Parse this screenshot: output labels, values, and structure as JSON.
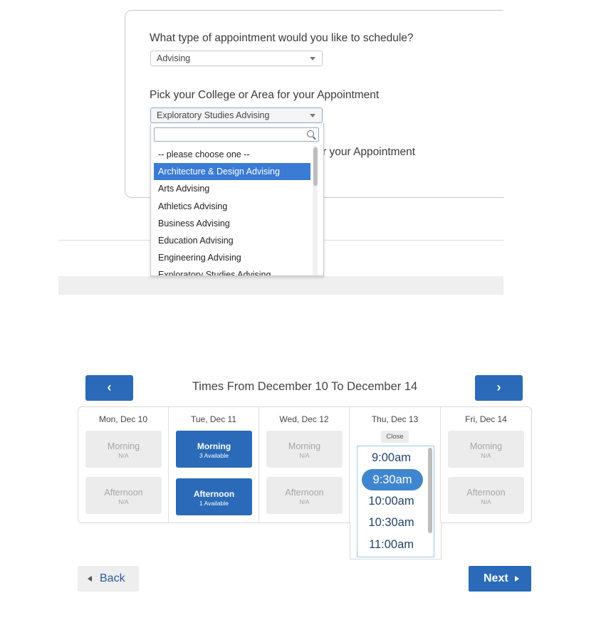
{
  "form": {
    "question1": "What type of appointment would you like to schedule?",
    "select1_value": "Advising",
    "question2": "Pick your College or Area for your Appointment",
    "select2_value": "Exploratory Studies Advising",
    "question3_partial": "r your Appointment",
    "dropdown": {
      "search_placeholder": "",
      "items": [
        {
          "label": "-- please choose one --",
          "selected": false
        },
        {
          "label": "Architecture & Design Advising",
          "selected": true
        },
        {
          "label": "Arts Advising",
          "selected": false
        },
        {
          "label": "Athletics Advising",
          "selected": false
        },
        {
          "label": "Business Advising",
          "selected": false
        },
        {
          "label": "Education Advising",
          "selected": false
        },
        {
          "label": "Engineering Advising",
          "selected": false
        },
        {
          "label": "Exploratory Studies Advising",
          "selected": false
        }
      ]
    }
  },
  "calendar": {
    "title": "Times From December 10 To December 14",
    "prev_icon": "‹",
    "next_icon": "›",
    "days": [
      {
        "label": "Mon, Dec 10",
        "morning": {
          "title": "Morning",
          "sub": "N/A"
        },
        "afternoon": {
          "title": "Afternoon",
          "sub": "N/A"
        }
      },
      {
        "label": "Tue, Dec 11",
        "morning": {
          "title": "Morning",
          "sub": "3 Available"
        },
        "afternoon": {
          "title": "Afternoon",
          "sub": "1 Available"
        }
      },
      {
        "label": "Wed, Dec 12",
        "morning": {
          "title": "Morning",
          "sub": "N/A"
        },
        "afternoon": {
          "title": "Afternoon",
          "sub": "N/A"
        }
      },
      {
        "label": "Thu, Dec 13",
        "close_label": "Close",
        "times": [
          "9:00am",
          "9:30am",
          "10:00am",
          "10:30am",
          "11:00am"
        ],
        "selected_time": "9:30am"
      },
      {
        "label": "Fri, Dec 14",
        "morning": {
          "title": "Morning",
          "sub": "N/A"
        },
        "afternoon": {
          "title": "Afternoon",
          "sub": "N/A"
        }
      }
    ]
  },
  "footer": {
    "back_label": "Back",
    "next_label": "Next"
  },
  "colors": {
    "primary": "#2a6ab8",
    "selected_item": "#3a7bd5",
    "selected_time": "#3f86cf",
    "slot_disabled": "#ececec"
  }
}
